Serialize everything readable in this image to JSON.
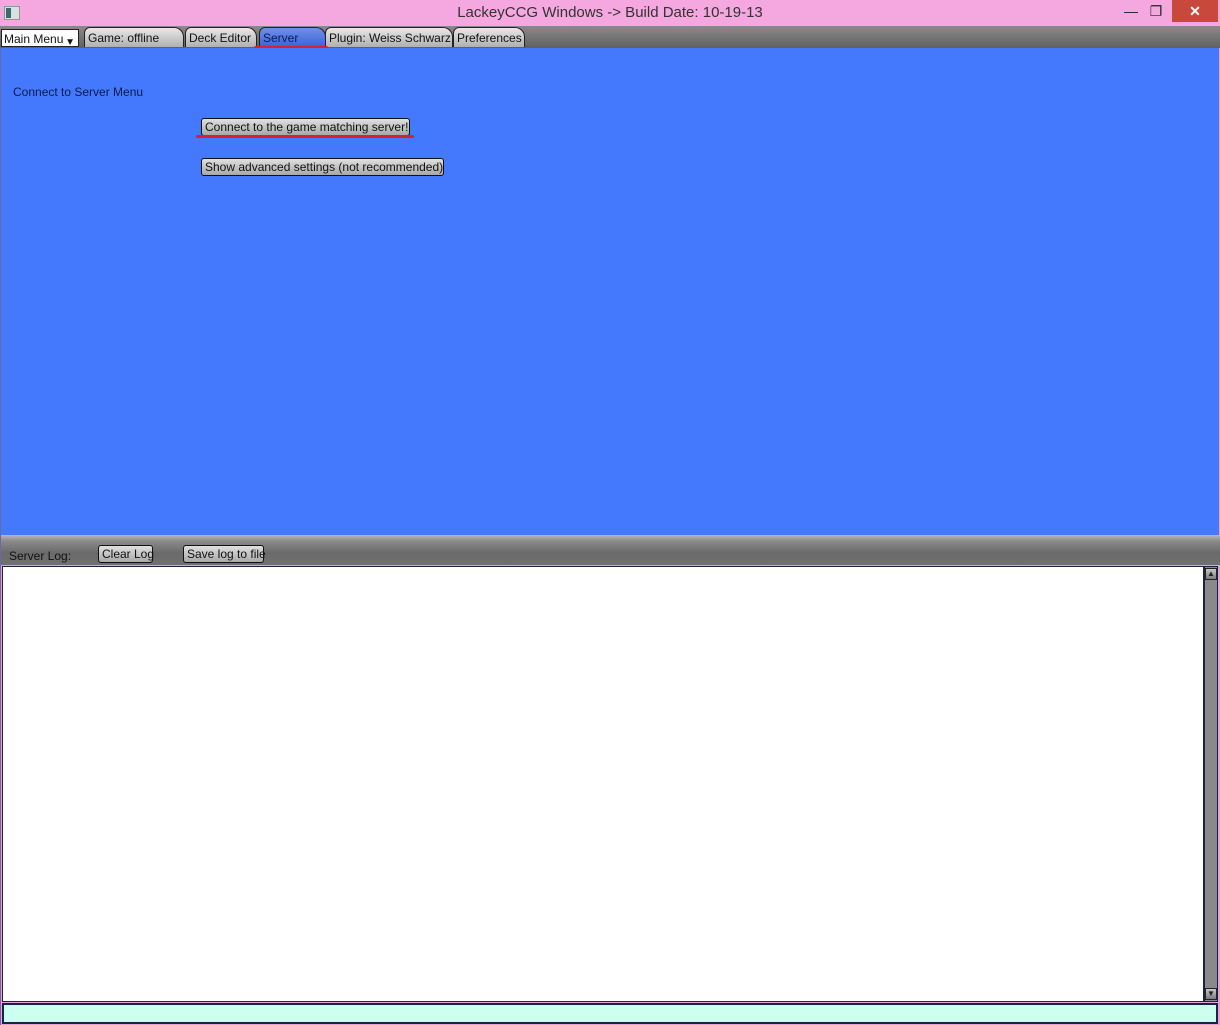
{
  "window": {
    "title": "LackeyCCG Windows -> Build Date: 10-19-13",
    "minimize_icon": "—",
    "restore_icon": "❐",
    "close_icon": "✕"
  },
  "tabbar": {
    "main_menu": "Main Menu",
    "main_menu_arrow": "▼",
    "tabs": [
      {
        "label": "Game: offline"
      },
      {
        "label": "Deck Editor"
      },
      {
        "label": "Server",
        "active": true
      },
      {
        "label": "Plugin: Weiss Schwarz"
      },
      {
        "label": "Preferences"
      }
    ]
  },
  "main": {
    "heading": "Connect to Server Menu",
    "connect_button": "Connect to the game matching server!",
    "advanced_button": "Show advanced settings (not recommended)"
  },
  "log": {
    "label": "Server Log:",
    "clear_button": "Clear Log",
    "save_button": "Save log to file",
    "content": "",
    "scroll_up_icon": "▲",
    "scroll_down_icon": "▼"
  },
  "chat_input": {
    "value": ""
  },
  "colors": {
    "main_bg": "#4479fe",
    "titlebar_bg": "#f4a8df",
    "annotation_red": "#d82030",
    "chat_bg": "#ccfff0"
  }
}
